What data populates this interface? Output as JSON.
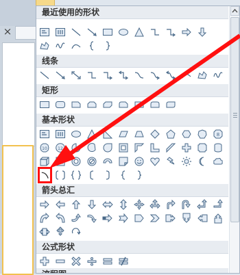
{
  "sections": [
    {
      "id": "recent",
      "title": "最近使用的形状",
      "rows": [
        [
          "text-box",
          "vertical-text-box",
          "line",
          "line-arrow",
          "rectangle",
          "oval",
          "triangle",
          "elbow-connector",
          "elbow-connector-2",
          "right-arrow",
          "down-arrow"
        ],
        [
          "freeform",
          "scribble",
          "curve",
          "left-brace",
          "right-brace"
        ]
      ]
    },
    {
      "id": "lines",
      "title": "线条",
      "rows": [
        [
          "line",
          "line-arrow",
          "double-arrow",
          "elbow-connector",
          "elbow-arrow",
          "elbow-double-arrow",
          "curved-connector",
          "curved-arrow",
          "curved-double-arrow",
          "curve",
          "freeform",
          "scribble"
        ]
      ]
    },
    {
      "id": "rect",
      "title": "矩形",
      "rows": [
        [
          "rectangle",
          "rounded-rectangle",
          "snip-single",
          "snip-same",
          "snip-diagonal",
          "snip-round",
          "round-single",
          "round-same",
          "round-diagonal"
        ]
      ]
    },
    {
      "id": "basic",
      "title": "基本形状",
      "rows": [
        [
          "text-box",
          "vertical-text-box",
          "oval",
          "triangle",
          "right-triangle",
          "parallelogram",
          "trapezoid",
          "diamond",
          "pentagon",
          "hexagon",
          "heptagon",
          "octagon"
        ],
        [
          "decagon",
          "dodecagon",
          "pie",
          "chord",
          "teardrop",
          "frame",
          "half-frame",
          "l-shape",
          "diagonal-stripe",
          "cross",
          "plaque",
          "can"
        ],
        [
          "cube",
          "bevel",
          "donut",
          "no-symbol",
          "block-arc",
          "folded-corner",
          "smiley",
          "heart",
          "lightning",
          "sun",
          "moon",
          "cloud"
        ],
        [
          "arc",
          "double-bracket",
          "double-brace",
          "left-bracket",
          "right-bracket",
          "left-brace",
          "right-brace"
        ]
      ]
    },
    {
      "id": "arrows",
      "title": "箭头总汇",
      "rows": [
        [
          "right-arrow",
          "left-arrow",
          "up-arrow",
          "down-arrow",
          "left-right-arrow",
          "up-down-arrow",
          "quad-arrow",
          "left-right-up-arrow",
          "bent-arrow",
          "u-turn-arrow",
          "left-up-arrow",
          "bent-up-arrow"
        ],
        [
          "curved-right-arrow",
          "curved-left-arrow",
          "curved-up-arrow",
          "curved-down-arrow",
          "striped-right-arrow",
          "notched-right-arrow",
          "pentagon-arrow",
          "chevron",
          "right-arrow-callout",
          "down-arrow-callout",
          "left-arrow-callout",
          "up-arrow-callout"
        ],
        [
          "left-right-arrow-callout",
          "quad-arrow-callout",
          "circular-arrow"
        ]
      ]
    },
    {
      "id": "equation",
      "title": "公式形状",
      "rows": [
        [
          "plus",
          "minus",
          "multiply",
          "divide",
          "equal",
          "not-equal"
        ]
      ]
    },
    {
      "id": "flowchart",
      "title": "流程图",
      "rows": []
    }
  ],
  "highlighted_shape": "arc",
  "annotation": {
    "color": "#ff1010"
  }
}
